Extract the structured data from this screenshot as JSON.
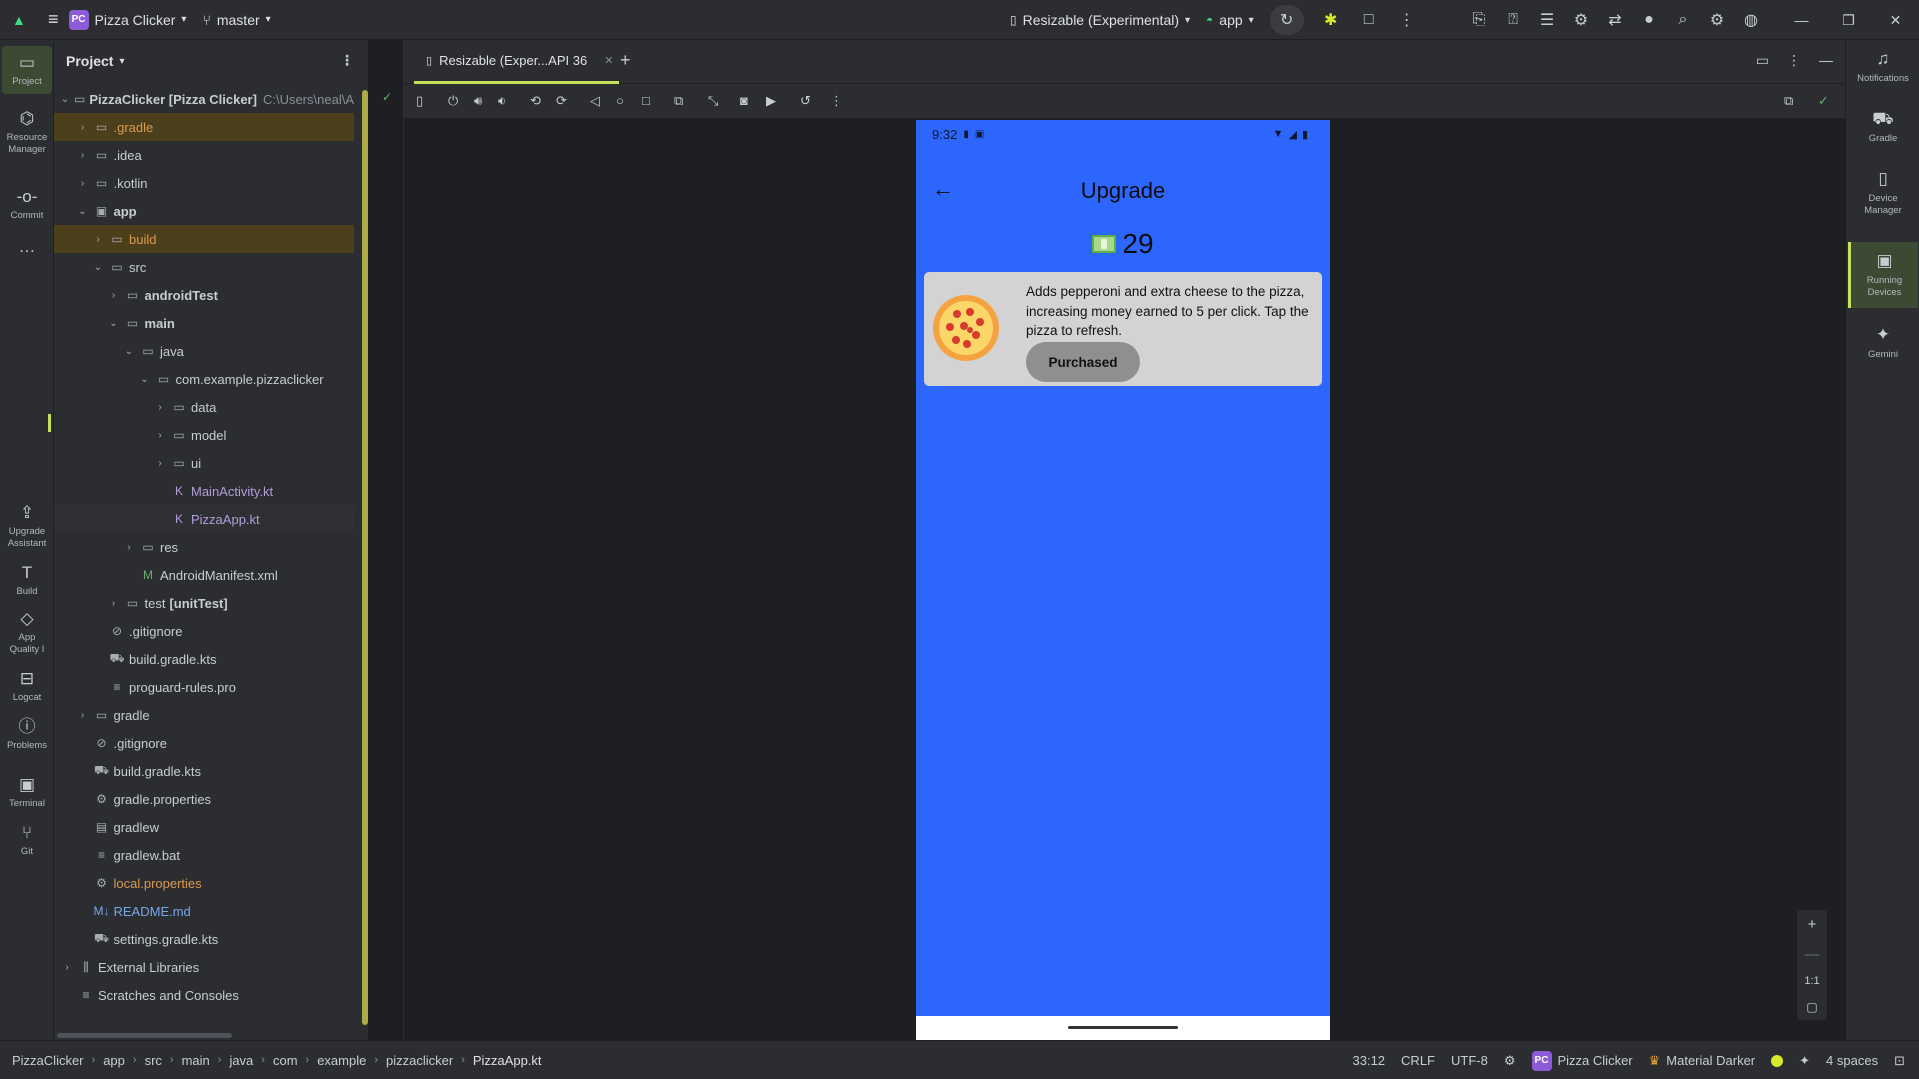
{
  "titlebar": {
    "project": "Pizza Clicker",
    "project_badge": "PC",
    "branch": "master",
    "device": "Resizable (Experimental)",
    "run_config": "app"
  },
  "left_strip": {
    "project": "Project",
    "resource_manager": "Resource Manager",
    "commit": "Commit",
    "more": "…",
    "upgrade_assistant": "Upgrade Assistant",
    "build": "Build",
    "app_quality": "App Quality I",
    "logcat": "Logcat",
    "problems": "Problems",
    "terminal": "Terminal",
    "git": "Git"
  },
  "project_panel": {
    "title": "Project",
    "tree": [
      {
        "label": "PizzaClicker [Pizza Clicker]",
        "extra": "C:\\Users\\neal\\A",
        "depth": 0,
        "chev": "v",
        "icon": "folder",
        "cls": "c-bold"
      },
      {
        "label": ".gradle",
        "depth": 1,
        "chev": ">",
        "icon": "folder",
        "cls": "c-orange",
        "hl": true
      },
      {
        "label": ".idea",
        "depth": 1,
        "chev": ">",
        "icon": "folder",
        "cls": ""
      },
      {
        "label": ".kotlin",
        "depth": 1,
        "chev": ">",
        "icon": "folder",
        "cls": ""
      },
      {
        "label": "app",
        "depth": 1,
        "chev": "v",
        "icon": "module",
        "cls": "c-bold"
      },
      {
        "label": "build",
        "depth": 2,
        "chev": ">",
        "icon": "folder",
        "cls": "c-orange",
        "hl": true
      },
      {
        "label": "src",
        "depth": 2,
        "chev": "v",
        "icon": "folder",
        "cls": ""
      },
      {
        "label": "androidTest",
        "depth": 3,
        "chev": ">",
        "icon": "folder",
        "cls": "c-bold"
      },
      {
        "label": "main",
        "depth": 3,
        "chev": "v",
        "icon": "folder",
        "cls": "c-bold"
      },
      {
        "label": "java",
        "depth": 4,
        "chev": "v",
        "icon": "folder",
        "cls": ""
      },
      {
        "label": "com.example.pizzaclicker",
        "depth": 5,
        "chev": "v",
        "icon": "folder",
        "cls": ""
      },
      {
        "label": "data",
        "depth": 6,
        "chev": ">",
        "icon": "folder",
        "cls": ""
      },
      {
        "label": "model",
        "depth": 6,
        "chev": ">",
        "icon": "folder",
        "cls": ""
      },
      {
        "label": "ui",
        "depth": 6,
        "chev": ">",
        "icon": "folder",
        "cls": ""
      },
      {
        "label": "MainActivity.kt",
        "depth": 6,
        "chev": "",
        "icon": "kotlin",
        "cls": "c-purple"
      },
      {
        "label": "PizzaApp.kt",
        "depth": 6,
        "chev": "",
        "icon": "kotlin",
        "cls": "c-purple",
        "sel": true
      },
      {
        "label": "res",
        "depth": 4,
        "chev": ">",
        "icon": "folder",
        "cls": ""
      },
      {
        "label": "AndroidManifest.xml",
        "depth": 4,
        "chev": "",
        "icon": "manifest",
        "cls": ""
      },
      {
        "label": "test",
        "extra_bold": "[unitTest]",
        "depth": 3,
        "chev": ">",
        "icon": "folder",
        "cls": ""
      },
      {
        "label": ".gitignore",
        "depth": 2,
        "chev": "",
        "icon": "ignore",
        "cls": ""
      },
      {
        "label": "build.gradle.kts",
        "depth": 2,
        "chev": "",
        "icon": "gradle",
        "cls": ""
      },
      {
        "label": "proguard-rules.pro",
        "depth": 2,
        "chev": "",
        "icon": "text",
        "cls": ""
      },
      {
        "label": "gradle",
        "depth": 1,
        "chev": ">",
        "icon": "folder",
        "cls": ""
      },
      {
        "label": ".gitignore",
        "depth": 1,
        "chev": "",
        "icon": "ignore",
        "cls": ""
      },
      {
        "label": "build.gradle.kts",
        "depth": 1,
        "chev": "",
        "icon": "gradle",
        "cls": ""
      },
      {
        "label": "gradle.properties",
        "depth": 1,
        "chev": "",
        "icon": "settings",
        "cls": ""
      },
      {
        "label": "gradlew",
        "depth": 1,
        "chev": "",
        "icon": "terminal",
        "cls": ""
      },
      {
        "label": "gradlew.bat",
        "depth": 1,
        "chev": "",
        "icon": "text",
        "cls": ""
      },
      {
        "label": "local.properties",
        "depth": 1,
        "chev": "",
        "icon": "settings",
        "cls": "c-orange"
      },
      {
        "label": "README.md",
        "depth": 1,
        "chev": "",
        "icon": "markdown",
        "cls": "c-blue"
      },
      {
        "label": "settings.gradle.kts",
        "depth": 1,
        "chev": "",
        "icon": "gradle",
        "cls": ""
      },
      {
        "label": "External Libraries",
        "depth": 0,
        "chev": ">",
        "icon": "library",
        "cls": ""
      },
      {
        "label": "Scratches and Consoles",
        "depth": 0,
        "chev": "",
        "icon": "scratch",
        "cls": ""
      }
    ]
  },
  "editor": {
    "tab_label": "Resizable (Exper...API 36"
  },
  "phone": {
    "time": "9:32",
    "title": "Upgrade",
    "money": "29",
    "upgrade_desc": "Adds pepperoni and extra cheese to the pizza, increasing money earned to 5 per click. Tap the pizza to refresh.",
    "button_label": "Purchased",
    "colors": {
      "background": "#2d66fc",
      "card": "#d3d3d4",
      "button": "#8f8f91"
    }
  },
  "zoom": {
    "plus": "+",
    "minus": "—",
    "one_to_one": "1:1"
  },
  "right_strip": {
    "notifications": "Notifications",
    "gradle": "Gradle",
    "device_manager": "Device Manager",
    "running_devices": "Running Devices",
    "gemini": "Gemini"
  },
  "statusbar": {
    "crumbs": [
      "PizzaClicker",
      "app",
      "src",
      "main",
      "java",
      "com",
      "example",
      "pizzaclicker",
      "PizzaApp.kt"
    ],
    "position": "33:12",
    "line_sep": "CRLF",
    "encoding": "UTF-8",
    "project": "Pizza Clicker",
    "project_badge": "PC",
    "theme": "Material Darker",
    "indent": "4 spaces"
  }
}
